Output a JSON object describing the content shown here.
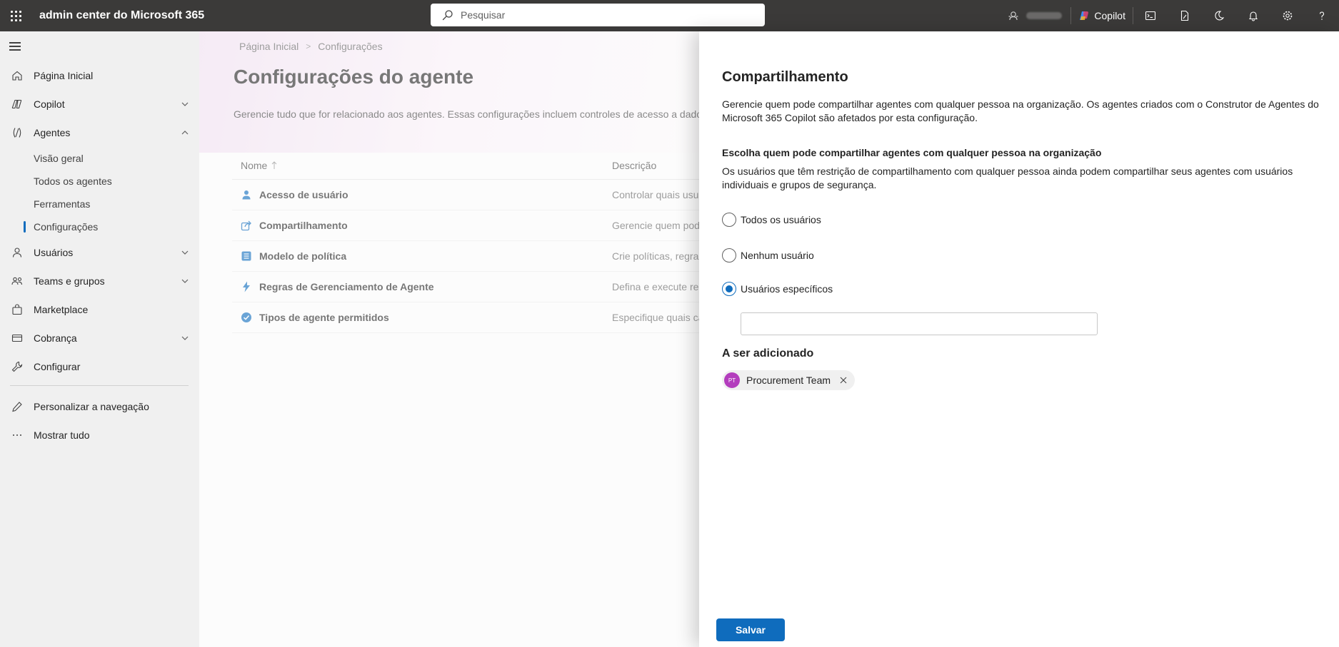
{
  "header": {
    "app_title": "admin center do Microsoft 365",
    "search_placeholder": "Pesquisar",
    "copilot_label": "Copilot"
  },
  "sidebar": {
    "items": [
      {
        "label": "Página Inicial",
        "icon": "home-icon"
      },
      {
        "label": "Copilot",
        "icon": "copilot-icon",
        "expandable": true
      },
      {
        "label": "Agentes",
        "icon": "agents-icon",
        "expanded": true
      },
      {
        "label": "Usuários",
        "icon": "person-icon",
        "expandable": true
      },
      {
        "label": "Teams e grupos",
        "icon": "people-icon",
        "expandable": true
      },
      {
        "label": "Marketplace",
        "icon": "bag-icon"
      },
      {
        "label": "Cobrança",
        "icon": "card-icon",
        "expandable": true
      },
      {
        "label": "Configurar",
        "icon": "wrench-icon"
      },
      {
        "label": "Personalizar a navegação",
        "icon": "pencil-icon"
      },
      {
        "label": "Mostrar tudo",
        "icon": "more-icon"
      }
    ],
    "agent_subitems": [
      "Visão geral",
      "Todos os agentes",
      "Ferramentas",
      "Configurações"
    ],
    "active_subitem": "Configurações"
  },
  "main": {
    "breadcrumb": [
      "Página Inicial",
      "Configurações"
    ],
    "title": "Configurações do agente",
    "description": "Gerencie tudo que for relacionado aos agentes. Essas configurações incluem controles de acesso a dados,",
    "table": {
      "columns": [
        "Nome",
        "Descrição"
      ],
      "rows": [
        {
          "name": "Acesso de usuário",
          "description": "Controlar quais usu",
          "icon": "person-icon"
        },
        {
          "name": "Compartilhamento",
          "description": "Gerencie quem pod",
          "icon": "share-icon"
        },
        {
          "name": "Modelo de política",
          "description": "Crie políticas, regra",
          "icon": "list-icon"
        },
        {
          "name": "Regras de Gerenciamento de Agente",
          "description": "Defina e execute re",
          "icon": "flash-icon"
        },
        {
          "name": "Tipos de agente permitidos",
          "description": "Especifique quais ca",
          "icon": "check-circle-icon"
        }
      ]
    }
  },
  "panel": {
    "title": "Compartilhamento",
    "description": "Gerencie quem pode compartilhar agentes com qualquer pessoa na organização. Os agentes criados com o Construtor de Agentes do Microsoft 365 Copilot são afetados por esta configuração.",
    "section_label": "Escolha quem pode compartilhar agentes com qualquer pessoa na organização",
    "section_description": "Os usuários que têm restrição de compartilhamento com qualquer pessoa ainda podem compartilhar seus agentes com usuários individuais e grupos de segurança.",
    "options": [
      "Todos os usuários",
      "Nenhum usuário",
      "Usuários específicos"
    ],
    "selected_option": "Usuários específicos",
    "picker_value": "",
    "added_title": "A ser adicionado",
    "added_items": [
      {
        "initials": "PT",
        "name": "Procurement Team",
        "color": "#b33dbd"
      }
    ],
    "save_label": "Salvar"
  },
  "colors": {
    "accent": "#0f6cbd",
    "topbar": "#3b3a39"
  }
}
